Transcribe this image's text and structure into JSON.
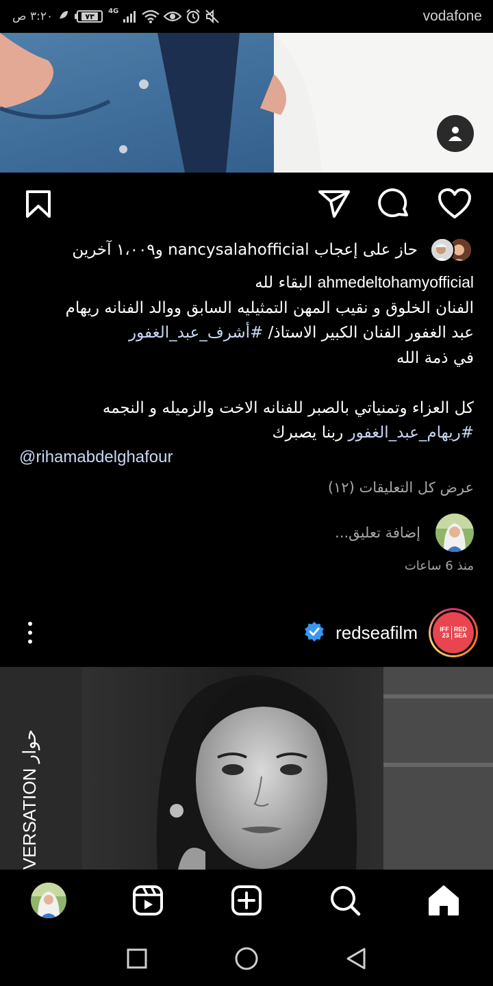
{
  "status_bar": {
    "time": "٣:٢٠ ص",
    "battery_level": "٧٣",
    "network": "4G",
    "carrier": "vodafone",
    "icons": [
      "leaf-icon",
      "battery-icon",
      "signal-icon",
      "wifi-icon",
      "eye-icon",
      "alarm-icon",
      "mute-icon"
    ]
  },
  "post1": {
    "likes": {
      "text": "حاز على إعجاب nancysalahofficial و١،٠٠٩ آخرين"
    },
    "caption": {
      "username": "ahmedeltohamyofficial",
      "first_line_text": "البقاء لله",
      "line2": "الفنان الخلوق و نقيب المهن التمثيليه السابق ووالد الفنانه ريهام",
      "line3_text": "عبد الغفور الفنان الكبير الاستاذ/ ",
      "line3_hashtag": "#أشرف_عبد_الغفور",
      "line4": "في ذمة الله",
      "line5": "كل العزاء وتمنياتي بالصبر للفنانه الاخت والزميله و النجمه",
      "line6_hashtag": "#ريهام_عبد_الغفور",
      "line6_text": " ربنا يصبرك",
      "mention": "@rihamabdelghafour"
    },
    "view_comments": "عرض كل التعليقات (١٢)",
    "add_comment_placeholder": "إضافة تعليق...",
    "time_ago": "منذ 6 ساعات"
  },
  "post2": {
    "username": "redseafilm",
    "verified": true,
    "logo_lines_left": [
      "RED",
      "SEA"
    ],
    "logo_lines_right": [
      "IFF",
      "23"
    ],
    "photo_overlay_text": "VERSATION حوار"
  },
  "colors": {
    "background": "#000000",
    "text": "#ffffff",
    "secondary_text": "#a8a8a8",
    "link": "#c9d8f5",
    "verified": "#3897f0",
    "redsea": "#e8454f"
  }
}
